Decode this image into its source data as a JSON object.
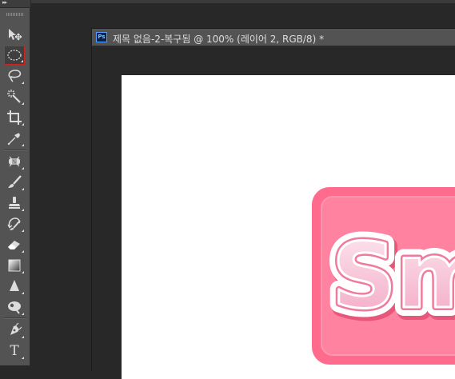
{
  "toolbar": {
    "collapse_glyph": "▸▸",
    "tools": [
      {
        "name": "move-tool",
        "icon": "move-icon",
        "active": false
      },
      {
        "name": "elliptical-marquee-tool",
        "icon": "elliptical-marquee-icon",
        "active": true
      },
      {
        "name": "lasso-tool",
        "icon": "lasso-icon",
        "active": false
      },
      {
        "name": "magic-wand-tool",
        "icon": "magic-wand-icon",
        "active": false
      },
      {
        "name": "crop-tool",
        "icon": "crop-icon",
        "active": false
      },
      {
        "name": "eyedropper-tool",
        "icon": "eyedropper-icon",
        "active": false
      },
      {
        "name": "spot-healing-tool",
        "icon": "bandage-icon",
        "active": false
      },
      {
        "name": "brush-tool",
        "icon": "brush-icon",
        "active": false
      },
      {
        "name": "clone-stamp-tool",
        "icon": "stamp-icon",
        "active": false
      },
      {
        "name": "history-brush-tool",
        "icon": "history-brush-icon",
        "active": false
      },
      {
        "name": "eraser-tool",
        "icon": "eraser-icon",
        "active": false
      },
      {
        "name": "gradient-tool",
        "icon": "gradient-icon",
        "active": false
      },
      {
        "name": "blur-tool",
        "icon": "blur-icon",
        "active": false
      },
      {
        "name": "dodge-tool",
        "icon": "dodge-icon",
        "active": false
      },
      {
        "name": "pen-tool",
        "icon": "pen-icon",
        "active": false
      },
      {
        "name": "type-tool",
        "icon": "type-icon",
        "active": false
      }
    ],
    "type_glyph": "T"
  },
  "document": {
    "app_badge": "Ps",
    "title": "제목 없음-2-복구됨 @ 100% (레이어 2, RGB/8) *"
  },
  "artwork": {
    "text": "Sm",
    "colors": {
      "badge": "#ff6b8c",
      "badge_inner": "#ff82a0",
      "text_fill_top": "#fce8f0",
      "text_fill_bottom": "#f3a6c2",
      "text_outline": "#ffffff",
      "text_shadow": "#e8577a"
    }
  },
  "colors": {
    "panel_bg": "#535353",
    "workspace_bg": "#282828",
    "active_tool_border": "#c92424",
    "icon_color": "#dcdcdc"
  }
}
